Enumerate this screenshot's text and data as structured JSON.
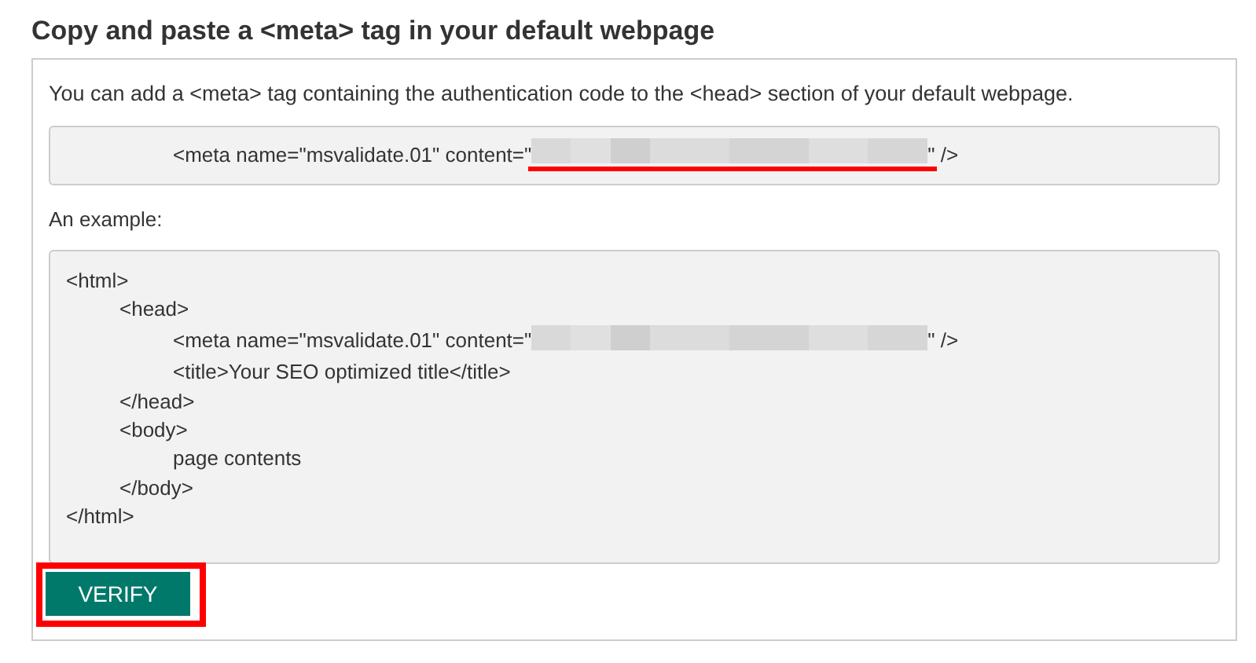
{
  "heading": "Copy and paste a <meta> tag in your default webpage",
  "intro": "You can add a <meta> tag containing the authentication code to the <head> section of your default webpage.",
  "meta_snippet": {
    "before": "<meta name=\"msvalidate.01\" content=\"",
    "after": "\" />"
  },
  "example_label": "An example:",
  "example_code": [
    {
      "kind": "block",
      "open": "<html>",
      "close": "</html>",
      "children": [
        {
          "kind": "block",
          "open": "<head>",
          "close": "</head>",
          "children": [
            {
              "kind": "redacted",
              "before": "<meta name=\"msvalidate.01\" content=\"",
              "after": "\" />"
            },
            {
              "kind": "line",
              "text": "<title>Your SEO optimized title</title>"
            }
          ]
        },
        {
          "kind": "block",
          "open": "<body>",
          "close": "</body>",
          "children": [
            {
              "kind": "line",
              "text": "page contents"
            }
          ]
        }
      ]
    }
  ],
  "button": "VERIFY"
}
